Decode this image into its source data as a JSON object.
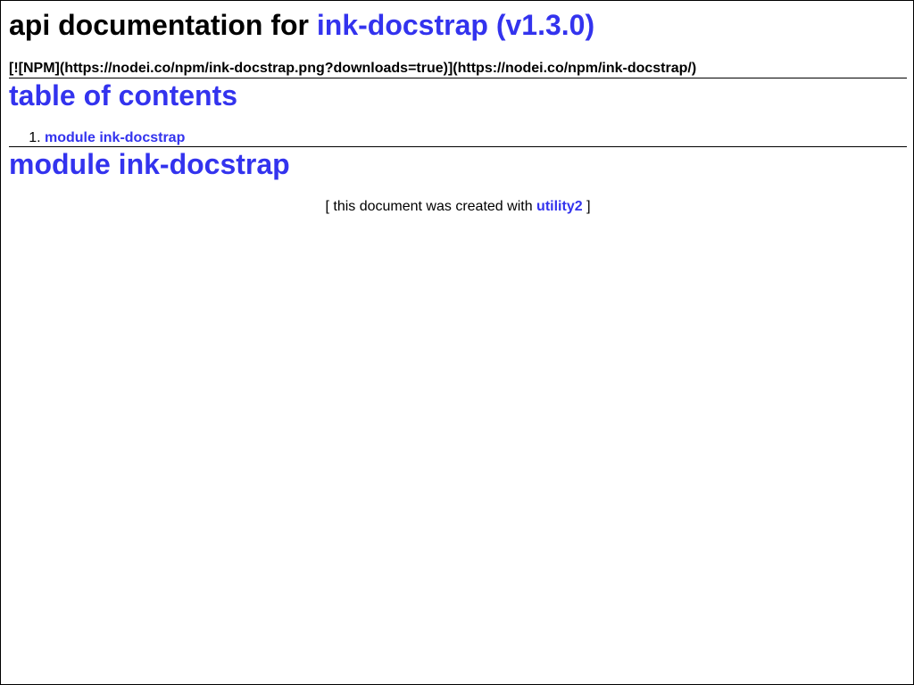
{
  "header": {
    "title_prefix": "api documentation for",
    "title_link": "ink-docstrap (v1.3.0)"
  },
  "badge_text": "[![NPM](https://nodei.co/npm/ink-docstrap.png?downloads=true)](https://nodei.co/npm/ink-docstrap/)",
  "toc": {
    "title": "table of contents",
    "items": [
      {
        "number": "1.",
        "label": "module ink-docstrap"
      }
    ]
  },
  "module": {
    "title": "module ink-docstrap"
  },
  "footer": {
    "open_bracket": "[",
    "text": "this document was created with",
    "link_label": "utility2",
    "close_bracket": "]"
  },
  "colors": {
    "link": "#3333ee",
    "text": "#000000",
    "background": "#ffffff"
  }
}
